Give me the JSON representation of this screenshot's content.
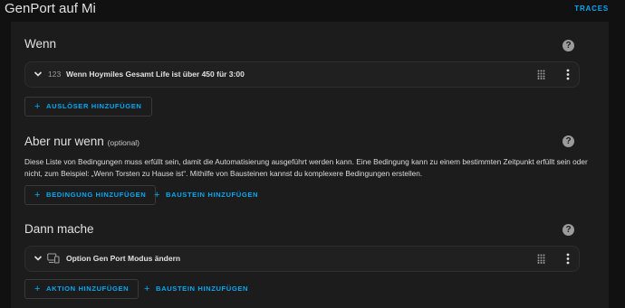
{
  "header": {
    "title": "GenPort auf Mi",
    "traces_label": "TRACES"
  },
  "colors": {
    "accent": "#03a9f4",
    "background": "#111111",
    "panel": "#1c1c1c",
    "card": "#202020"
  },
  "wenn": {
    "title": "Wenn",
    "help_icon": "help-circle-icon",
    "trigger": {
      "icon_text": "123",
      "label": "Wenn Hoymiles Gesamt Life ist über 450 für 3:00"
    },
    "add_trigger_label": "AUSLÖSER HINZUFÜGEN"
  },
  "conditions": {
    "title": "Aber nur wenn",
    "subtitle": "(optional)",
    "description": "Diese Liste von Bedingungen muss erfüllt sein, damit die Automatisierung ausgeführt werden kann. Eine Bedingung kann zu einem bestimmten Zeitpunkt erfüllt sein oder nicht, zum Beispiel: „Wenn Torsten zu Hause ist“. Mithilfe von Bausteinen kannst du komplexere Bedingungen erstellen.",
    "add_condition_label": "BEDINGUNG HINZUFÜGEN",
    "add_block_label": "BAUSTEIN HINZUFÜGEN"
  },
  "actions": {
    "title": "Dann mache",
    "action": {
      "icon": "devices-icon",
      "label": "Option Gen Port Modus ändern"
    },
    "add_action_label": "AKTION HINZUFÜGEN",
    "add_block_label": "BAUSTEIN HINZUFÜGEN"
  }
}
